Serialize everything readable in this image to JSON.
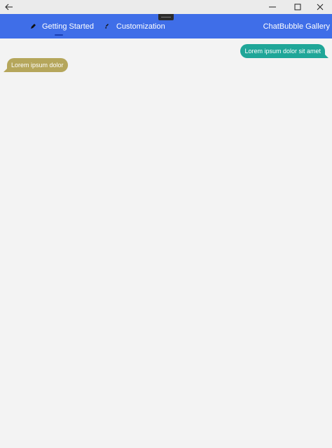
{
  "titlebar": {
    "back_icon": "back-arrow-icon",
    "minimize_icon": "minimize-icon",
    "maximize_icon": "maximize-icon",
    "close_icon": "close-icon"
  },
  "navbar": {
    "background": "#3f6ee8",
    "tabs": [
      {
        "label": "Getting Started",
        "icon": "pencil-icon",
        "selected": true
      },
      {
        "label": "Customization",
        "icon": "brush-icon",
        "selected": false
      }
    ],
    "app_title": "ChatBubble Gallery"
  },
  "chat": {
    "messages": [
      {
        "text": "Lorem ipsum dolor sit amet",
        "direction": "outgoing",
        "color": "#1fa698"
      },
      {
        "text": "Lorem ipsum dolor",
        "direction": "incoming",
        "color": "#b5a65b"
      }
    ]
  }
}
